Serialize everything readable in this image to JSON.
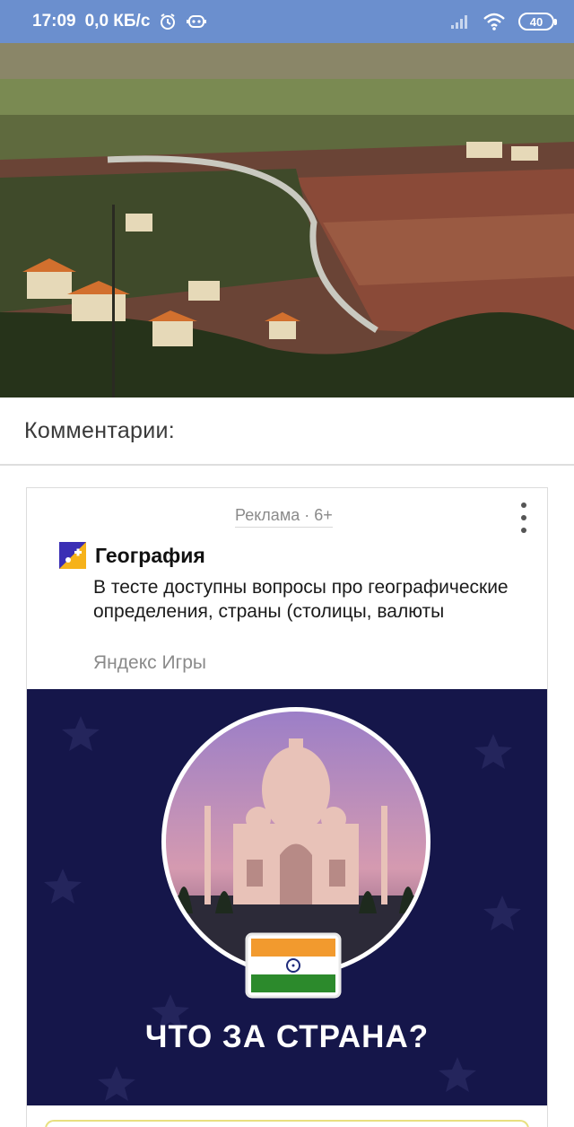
{
  "status_bar": {
    "time": "17:09",
    "network_speed": "0,0 КБ/с",
    "battery_level": "40",
    "icons": [
      "alarm-icon",
      "assistant-icon",
      "signal-icon",
      "wifi-icon",
      "battery-icon"
    ]
  },
  "hero": {
    "alt_subject": "landscape-photo"
  },
  "comments": {
    "header": "Комментарии:"
  },
  "ad": {
    "label": "Реклама · 6+",
    "brand_name": "География",
    "description": "В тесте доступны вопросы про географические определения, страны (столицы, валюты",
    "source": "Яндекс Игры",
    "creative_caption": "ЧТО ЗА СТРАНА?",
    "colors": {
      "creative_background": "#15164a",
      "status_bar": "#6b8fce"
    }
  }
}
